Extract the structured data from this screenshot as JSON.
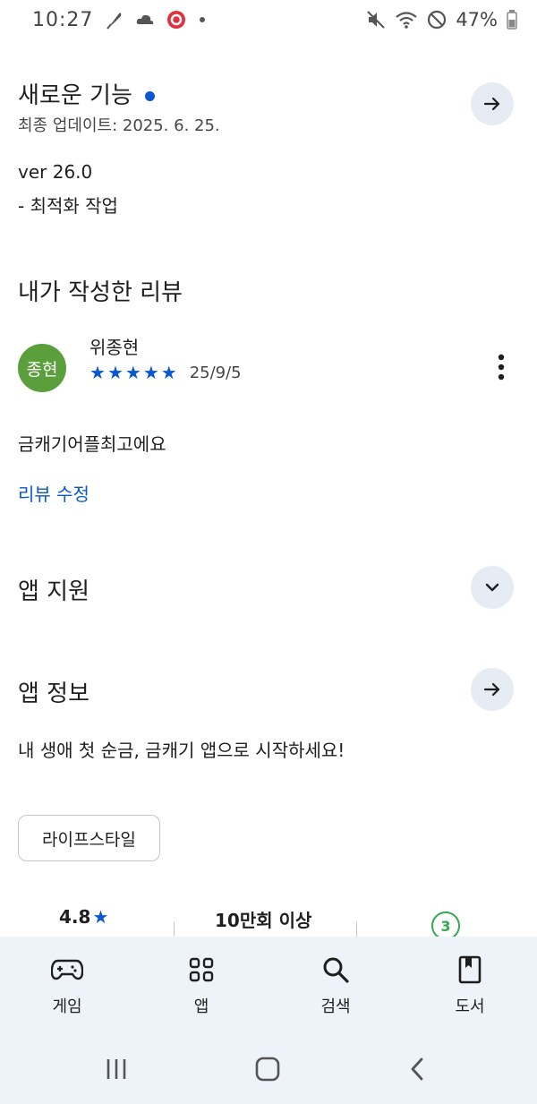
{
  "status_bar": {
    "time": "10:27",
    "battery": "47%"
  },
  "whats_new": {
    "title": "새로운 기능",
    "updated": "최종 업데이트: 2025. 6. 25.",
    "version": "ver 26.0",
    "note": "- 최적화 작업"
  },
  "my_review": {
    "title": "내가 작성한 리뷰",
    "avatar_text": "종현",
    "reviewer": "위종현",
    "stars": 5,
    "date": "25/9/5",
    "text": "금캐기어플최고에요",
    "edit_link": "리뷰 수정"
  },
  "app_support": {
    "title": "앱 지원"
  },
  "app_info": {
    "title": "앱 정보",
    "description": "내 생애 첫 순금, 금캐기 앱으로 시작하세요!",
    "category_chip": "라이프스타일"
  },
  "stats": {
    "rating": "4.8",
    "downloads": "10만회 이상",
    "content_rating": "3"
  },
  "bottom_nav": {
    "items": [
      {
        "label": "게임",
        "icon": "gamepad-icon"
      },
      {
        "label": "앱",
        "icon": "apps-grid-icon"
      },
      {
        "label": "검색",
        "icon": "search-icon"
      },
      {
        "label": "도서",
        "icon": "book-icon"
      }
    ]
  },
  "colors": {
    "accent": "#0b57d0",
    "avatar": "#5a9f3c",
    "nav_bg": "#eef2f9",
    "button_bg": "#e6ebf4",
    "content_rating": "#34a853"
  }
}
